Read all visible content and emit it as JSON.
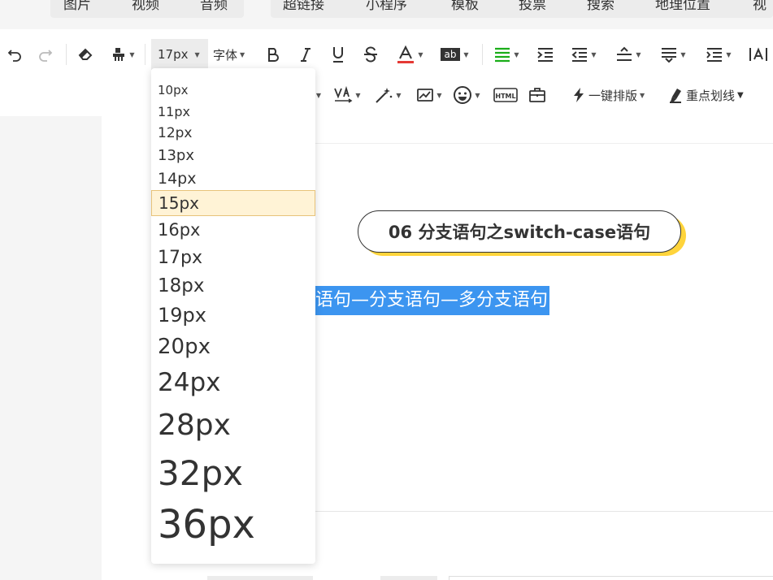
{
  "top_tabs": [
    "图片",
    "视频",
    "音频",
    "超链接",
    "小程序",
    "模板",
    "投票",
    "搜索",
    "地理位置",
    "视"
  ],
  "toolbar": {
    "font_size_value": "17px",
    "font_family_label": "字体",
    "one_click_layout_label": "一键排版",
    "highlight_underline_label": "重点划线",
    "icons": [
      "undo-icon",
      "redo-icon",
      "eraser-icon",
      "format-painter-icon",
      "bold-icon",
      "italic-icon",
      "underline-icon",
      "strikethrough-icon",
      "font-color-icon",
      "highlight-icon",
      "align-left-icon",
      "indent-icon",
      "outdent-icon",
      "line-height-icon",
      "paragraph-spacing-icon",
      "text-indent-icon",
      "text-direction-icon",
      "letter-spacing-icon",
      "magic-wand-icon",
      "image-icon",
      "emoji-icon",
      "html-icon",
      "briefcase-icon",
      "lightning-icon",
      "marker-icon"
    ],
    "colors": {
      "font_color_bar": "#e53935",
      "align_active": "#1aad19"
    }
  },
  "font_size_options": [
    "10px",
    "11px",
    "12px",
    "13px",
    "14px",
    "15px",
    "16px",
    "17px",
    "18px",
    "19px",
    "20px",
    "24px",
    "28px",
    "32px",
    "36px"
  ],
  "font_size_highlighted": "15px",
  "editor": {
    "title_pill_text": "06 分支语句之switch-case语句",
    "selected_text": "语句—分支语句—多分支语句"
  },
  "colors": {
    "selection": "#3c95f0",
    "title_shadow": "#ffd43b",
    "dropdown_highlight": "#fff3d6"
  }
}
